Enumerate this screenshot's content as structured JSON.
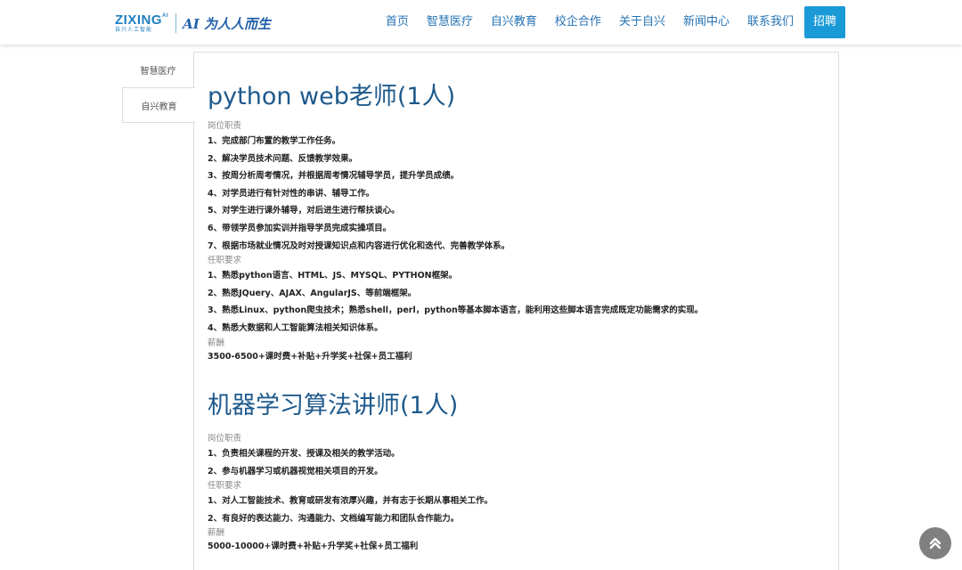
{
  "header": {
    "logo": {
      "brand": "ZIXING",
      "brand_sup": "AI",
      "brand_sub": "自兴人工智能",
      "slogan": "AI 为人人而生"
    },
    "nav": [
      "首页",
      "智慧医疗",
      "自兴教育",
      "校企合作",
      "关于自兴",
      "新闻中心",
      "联系我们",
      "招聘"
    ],
    "active_nav": "招聘"
  },
  "sidebar": {
    "items": [
      "智慧医疗",
      "自兴教育"
    ],
    "active": "自兴教育"
  },
  "jobs": [
    {
      "title": "python web老师(1人)",
      "duties_label": "岗位职责",
      "duties": [
        "1、完成部门布置的教学工作任务。",
        "2、解决学员技术问题、反馈教学效果。",
        "3、按周分析周考情况，并根据周考情况辅导学员，提升学员成绩。",
        "4、对学员进行有针对性的串讲、辅导工作。",
        "5、对学生进行课外辅导，对后进生进行帮扶谈心。",
        "6、带领学员参加实训并指导学员完成实操项目。",
        "7、根据市场就业情况及时对授课知识点和内容进行优化和迭代、完善教学体系。"
      ],
      "requirements_label": "任职要求",
      "requirements": [
        "1、熟悉python语言、HTML、JS、MYSQL、PYTHON框架。",
        "2、熟悉JQuery、AJAX、AngularJS、等前端框架。",
        "3、熟悉Linux、python爬虫技术；熟悉shell，perl，python等基本脚本语言，能利用这些脚本语言完成既定功能需求的实现。",
        "4、熟悉大数据和人工智能算法相关知识体系。"
      ],
      "salary_label": "薪酬",
      "salary": "3500-6500+课时费+补贴+升学奖+社保+员工福利"
    },
    {
      "title": "机器学习算法讲师(1人)",
      "duties_label": "岗位职责",
      "duties": [
        "1、负责相关课程的开发、授课及相关的教学活动。",
        "2、参与机器学习或机器视觉相关项目的开发。"
      ],
      "requirements_label": "任职要求",
      "requirements": [
        "1、对人工智能技术、教育或研发有浓厚兴趣，并有志于长期从事相关工作。",
        "2、有良好的表达能力、沟通能力、文档编写能力和团队合作能力。"
      ],
      "salary_label": "薪酬",
      "salary": "5000-10000+课时费+补贴+升学奖+社保+员工福利"
    }
  ],
  "back_to_top": {
    "icon": "double-chevron-up-icon"
  },
  "colors": {
    "nav_text": "#2673b5",
    "nav_active_bg": "#1a9ad6",
    "title": "#1e5a8c",
    "back_top_bg": "#808080"
  }
}
